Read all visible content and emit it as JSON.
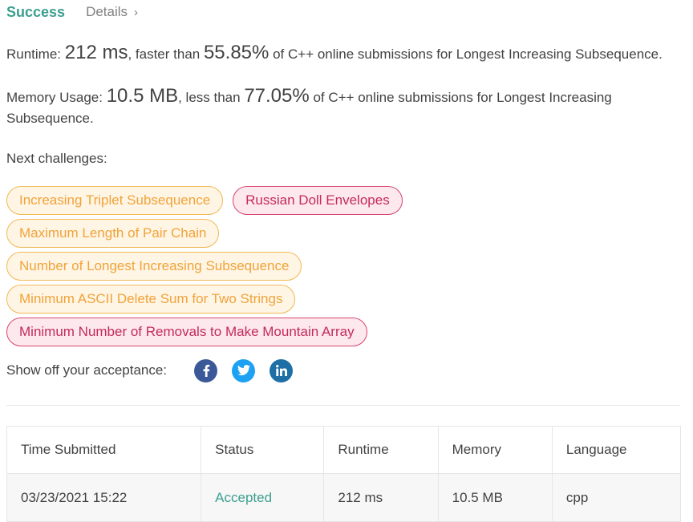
{
  "header": {
    "status": "Success",
    "details_label": "Details"
  },
  "runtime": {
    "label": "Runtime: ",
    "value": "212 ms",
    "mid": ", faster than ",
    "percent": "55.85%",
    "tail": " of C++ online submissions for Longest Increasing Subsequence."
  },
  "memory": {
    "label": "Memory Usage: ",
    "value": "10.5 MB",
    "mid": ", less than ",
    "percent": "77.05%",
    "tail": " of C++ online submissions for Longest Increasing Subsequence."
  },
  "next": {
    "label": "Next challenges:",
    "items": [
      {
        "title": "Increasing Triplet Subsequence",
        "difficulty": "medium"
      },
      {
        "title": "Russian Doll Envelopes",
        "difficulty": "hard"
      },
      {
        "title": "Maximum Length of Pair Chain",
        "difficulty": "medium"
      },
      {
        "title": "Number of Longest Increasing Subsequence",
        "difficulty": "medium"
      },
      {
        "title": "Minimum ASCII Delete Sum for Two Strings",
        "difficulty": "medium"
      },
      {
        "title": "Minimum Number of Removals to Make Mountain Array",
        "difficulty": "hard"
      }
    ]
  },
  "share": {
    "label": "Show off your acceptance:",
    "icons": [
      "facebook-icon",
      "twitter-icon",
      "linkedin-icon"
    ],
    "colors": {
      "facebook": "#3b5998",
      "twitter": "#1da1f2",
      "linkedin": "#1d6fa5"
    }
  },
  "table": {
    "headers": [
      "Time Submitted",
      "Status",
      "Runtime",
      "Memory",
      "Language"
    ],
    "rows": [
      {
        "time": "03/23/2021 15:22",
        "status": "Accepted",
        "runtime": "212 ms",
        "memory": "10.5 MB",
        "language": "cpp"
      }
    ]
  },
  "colors": {
    "accent": "#3b9f8f",
    "medium": "#f0a33a",
    "hard": "#c42b5b"
  }
}
